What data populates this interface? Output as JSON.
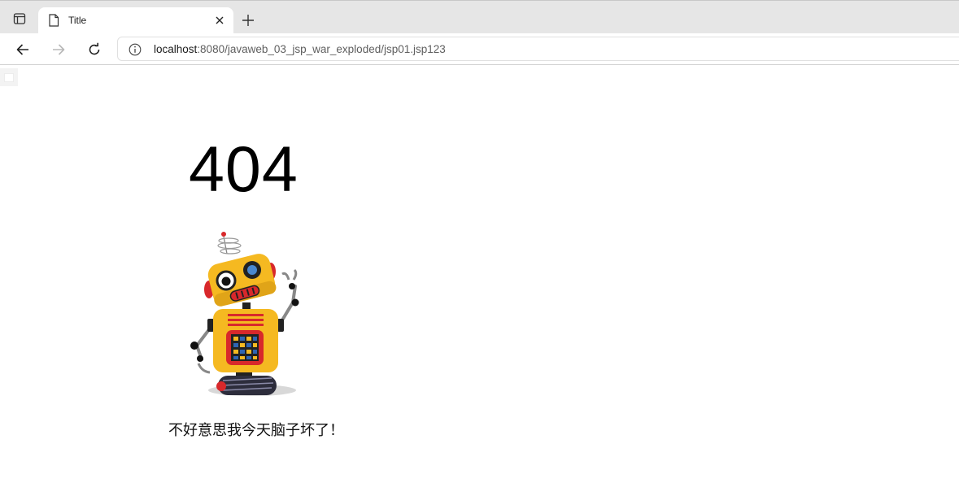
{
  "tab": {
    "title": "Title"
  },
  "address_bar": {
    "host": "localhost",
    "rest": ":8080/javaweb_03_jsp_war_exploded/jsp01.jsp123"
  },
  "page": {
    "error_code": "404",
    "message": "不好意思我今天脑子坏了！",
    "image": "robot-illustration"
  },
  "icons": {
    "tab_actions": "tab-actions-icon",
    "favicon": "page-icon",
    "close": "close-icon",
    "new_tab": "plus-icon",
    "back": "back-arrow-icon",
    "forward": "forward-arrow-icon",
    "reload": "reload-icon",
    "site_info": "info-icon"
  },
  "colors": {
    "robot_yellow": "#f5b921",
    "robot_red": "#d8282b",
    "robot_blue": "#2f65b4"
  }
}
